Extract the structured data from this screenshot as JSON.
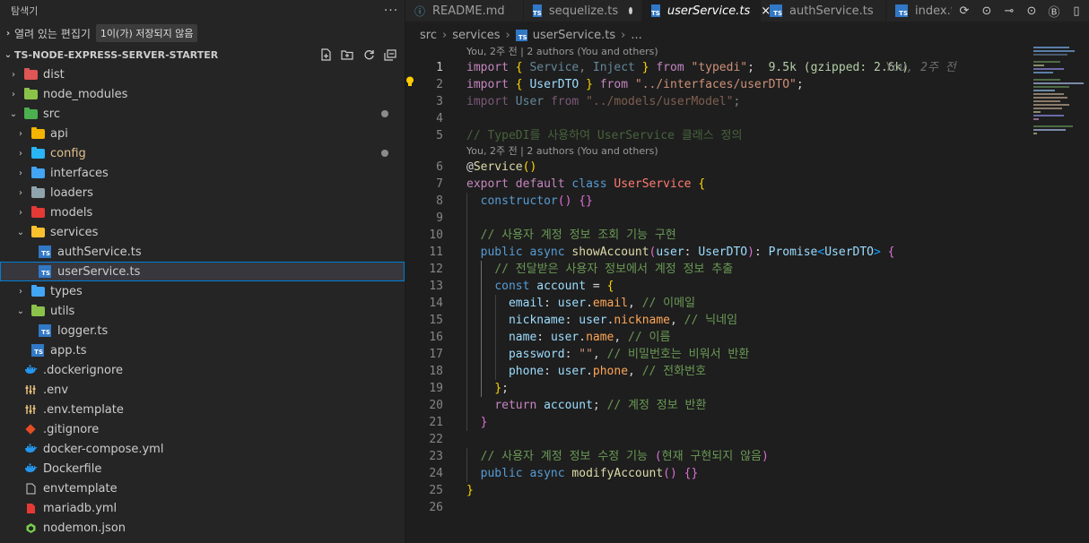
{
  "sidebar": {
    "title": "탐색기",
    "open_editors": {
      "label": "열려 있는 편집기",
      "badge": "1이(가) 저장되지 않음"
    },
    "project": {
      "label": "TS-NODE-EXPRESS-SERVER-STARTER"
    },
    "tree": [
      {
        "name": "dist",
        "depth": 0,
        "kind": "folder",
        "chev": "›",
        "color": "#e05555"
      },
      {
        "name": "node_modules",
        "depth": 0,
        "kind": "folder",
        "chev": "›",
        "color": "#8bc34a"
      },
      {
        "name": "src",
        "depth": 0,
        "kind": "folder",
        "chev": "⌄",
        "color": "#4caf50",
        "dot": true
      },
      {
        "name": "api",
        "depth": 1,
        "kind": "folder",
        "chev": "›",
        "color": "#f4b400"
      },
      {
        "name": "config",
        "depth": 1,
        "kind": "folder",
        "chev": "›",
        "color": "#29b6f6",
        "dot": true,
        "highlight": true
      },
      {
        "name": "interfaces",
        "depth": 1,
        "kind": "folder",
        "chev": "›",
        "color": "#42a5f5"
      },
      {
        "name": "loaders",
        "depth": 1,
        "kind": "folder",
        "chev": "›",
        "color": "#90a4ae"
      },
      {
        "name": "models",
        "depth": 1,
        "kind": "folder",
        "chev": "›",
        "color": "#e53935"
      },
      {
        "name": "services",
        "depth": 1,
        "kind": "folder",
        "chev": "⌄",
        "color": "#fbc02d"
      },
      {
        "name": "authService.ts",
        "depth": 2,
        "kind": "ts"
      },
      {
        "name": "userService.ts",
        "depth": 2,
        "kind": "ts",
        "selected": true
      },
      {
        "name": "types",
        "depth": 1,
        "kind": "folder",
        "chev": "›",
        "color": "#42a5f5"
      },
      {
        "name": "utils",
        "depth": 1,
        "kind": "folder",
        "chev": "⌄",
        "color": "#8bc34a"
      },
      {
        "name": "logger.ts",
        "depth": 2,
        "kind": "ts"
      },
      {
        "name": "app.ts",
        "depth": 1,
        "kind": "ts"
      },
      {
        "name": ".dockerignore",
        "depth": 0,
        "kind": "docker"
      },
      {
        "name": ".env",
        "depth": 0,
        "kind": "env"
      },
      {
        "name": ".env.template",
        "depth": 0,
        "kind": "env"
      },
      {
        "name": ".gitignore",
        "depth": 0,
        "kind": "git"
      },
      {
        "name": "docker-compose.yml",
        "depth": 0,
        "kind": "docker"
      },
      {
        "name": "Dockerfile",
        "depth": 0,
        "kind": "docker"
      },
      {
        "name": "envtemplate",
        "depth": 0,
        "kind": "file"
      },
      {
        "name": "mariadb.yml",
        "depth": 0,
        "kind": "yml"
      },
      {
        "name": "nodemon.json",
        "depth": 0,
        "kind": "nodemon"
      }
    ]
  },
  "tabs": [
    {
      "label": "README.md",
      "icon": "md"
    },
    {
      "label": "sequelize.ts",
      "icon": "ts",
      "dirty": true
    },
    {
      "label": "userService.ts",
      "icon": "ts",
      "active": true
    },
    {
      "label": "authService.ts",
      "icon": "ts"
    },
    {
      "label": "index.t",
      "icon": "ts"
    }
  ],
  "breadcrumbs": [
    "src",
    "services",
    "userService.ts",
    "..."
  ],
  "editor": {
    "codelens_1": "You, 2주 전 | 2 authors (You and others)",
    "codelens_6": "You, 2주 전 | 2 authors (You and others)",
    "import_cost": "9.5k (gzipped: 2.6k)",
    "blame_inline": "You, 2주 전",
    "current_line": 1
  },
  "colors": {
    "accent": "#007fd4",
    "ts_icon": "#3178c6",
    "sidebar_bg": "#252526",
    "editor_bg": "#1e1e1e"
  }
}
